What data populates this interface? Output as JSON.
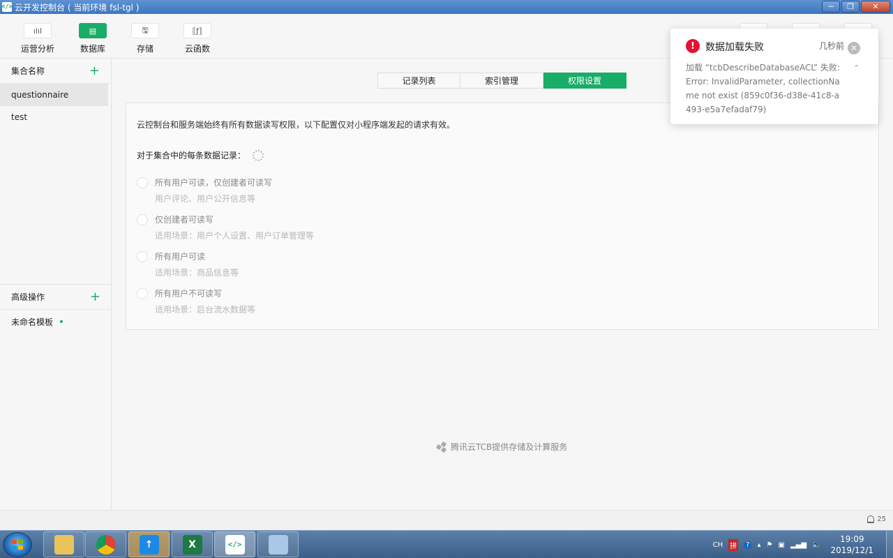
{
  "window": {
    "title": "云开发控制台 ( 当前环境 fsl-tgl )",
    "app_icon_glyph": "</>",
    "buttons": [
      "─",
      "❐",
      "✕"
    ]
  },
  "toolbar": {
    "items": [
      {
        "label": "运营分析",
        "icon": "bar-chart-icon",
        "glyph": "ılıl"
      },
      {
        "label": "数据库",
        "icon": "database-icon",
        "glyph": "▤"
      },
      {
        "label": "存储",
        "icon": "storage-icon",
        "glyph": "🖫"
      },
      {
        "label": "云函数",
        "icon": "function-icon",
        "glyph": "⟦ƒ⟧"
      }
    ]
  },
  "sidebar": {
    "collections_header": "集合名称",
    "collections": [
      "questionnaire",
      "test"
    ],
    "advanced_header": "高级操作",
    "templates": [
      "未命名模板"
    ],
    "plus": "+"
  },
  "tabs": [
    {
      "label": "记录列表",
      "active": false
    },
    {
      "label": "索引管理",
      "active": false
    },
    {
      "label": "权限设置",
      "active": true
    }
  ],
  "permissions": {
    "description": "云控制台和服务端始终有所有数据读写权限，以下配置仅对小程序端发起的请求有效。",
    "subheading": "对于集合中的每条数据记录：",
    "options": [
      {
        "title": "所有用户可读，仅创建者可读写",
        "hint": "用户评论、用户公开信息等"
      },
      {
        "title": "仅创建者可读写",
        "hint": "适用场景：用户个人设置、用户订单管理等"
      },
      {
        "title": "所有用户可读",
        "hint": "适用场景：商品信息等"
      },
      {
        "title": "所有用户不可读写",
        "hint": "适用场景：后台流水数据等"
      }
    ]
  },
  "footer": {
    "brand": "腾讯云TCB提供存储及计算服务"
  },
  "statusbar": {
    "notification_count": "25"
  },
  "toast": {
    "title": "数据加载失败",
    "time": "几秒前",
    "message": "加载 “tcbDescribeDatabaseACL” 失败:Error: InvalidParameter, collectionName not exist (859c0f36-d38e-41c8-a493-e5a7efadaf79)",
    "accent": "#e5112e"
  },
  "taskbar": {
    "apps": [
      "file-explorer-icon",
      "chrome-icon",
      "baidu-netdisk-icon",
      "excel-icon",
      "wechat-devtools-icon",
      "notepad-icon"
    ],
    "tray_lang": "CH",
    "time": "19:09",
    "date": "2019/12/1"
  },
  "colors": {
    "accent": "#19ad68",
    "titlebar": "#3d76bf"
  }
}
